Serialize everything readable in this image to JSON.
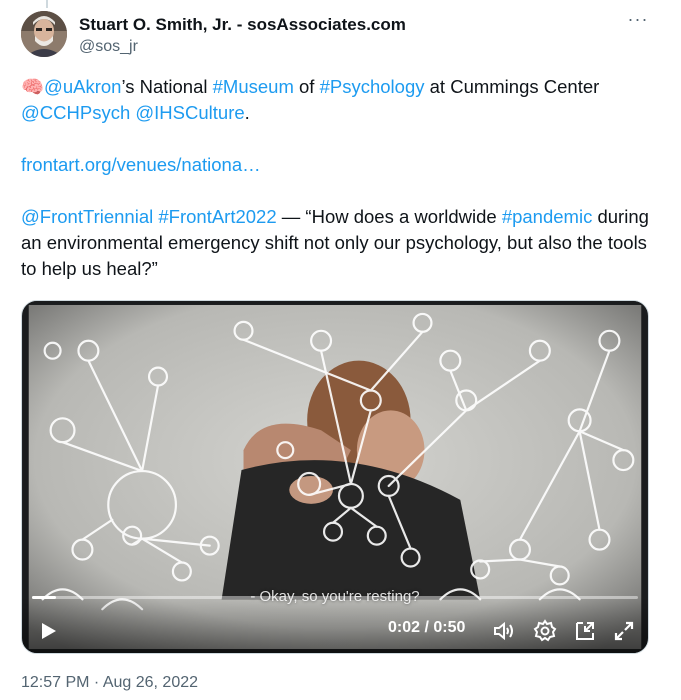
{
  "author": {
    "display_name": "Stuart O. Smith, Jr. - sosAssociates.com",
    "handle": "@sos_jr"
  },
  "tweet": {
    "line1": {
      "emoji": "🧠",
      "mention_uakron": "@uAkron",
      "t1": "’s National ",
      "hashtag_museum": "#Museum",
      "t2": " of ",
      "hashtag_psychology": "#Psychology",
      "t3": " at Cummings Center"
    },
    "line2": {
      "mention_cchpsych": "@CCHPsych",
      "mention_ihsculture": "@IHSCulture",
      "period": "."
    },
    "link": "frontart.org/venues/nationa…",
    "line3": {
      "mention_fronttriennial": "@FrontTriennial",
      "hashtag_frontart2022": "#FrontArt2022",
      "t1": " — “How does a worldwide ",
      "hashtag_pandemic": "#pandemic",
      "rest": "during an environmental emergency shift not only our psychology, but also the tools to help us heal?”"
    }
  },
  "video": {
    "subtitle": "- Okay, so you're resting?",
    "current_time": "0:02",
    "duration": "0:50",
    "time_display": "0:02 / 0:50",
    "progress": 0.04,
    "icons": [
      "play-icon",
      "volume-icon",
      "settings-icon",
      "picture-in-picture-icon",
      "fullscreen-icon"
    ]
  },
  "timestamp": "12:57 PM · Aug 26, 2022",
  "colors": {
    "link": "#1d9bf0",
    "text": "#0f1419",
    "muted": "#536471"
  }
}
